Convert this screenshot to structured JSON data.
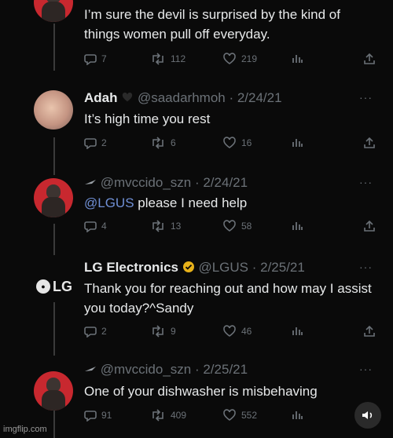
{
  "tweets": [
    {
      "text": "I’m sure the devil is surprised by the kind of things women pull off everyday.",
      "replies": "7",
      "retweets": "112",
      "likes": "219"
    },
    {
      "name": "Adah",
      "handle": "@saadarhmoh · 2/24/21",
      "text": "It’s high time you rest",
      "replies": "2",
      "retweets": "6",
      "likes": "16"
    },
    {
      "handle": "@mvccido_szn · 2/24/21",
      "mention": "@LGUS",
      "text": " please I need help",
      "replies": "4",
      "retweets": "13",
      "likes": "58"
    },
    {
      "name": "LG Electronics",
      "handle": "@LGUS · 2/25/21",
      "logo": "LG",
      "text": "Thank you for reaching out and how may I assist you today?^Sandy",
      "replies": "2",
      "retweets": "9",
      "likes": "46"
    },
    {
      "handle": "@mvccido_szn · 2/25/21",
      "text": "One of your dishwasher is misbehaving",
      "replies": "91",
      "retweets": "409",
      "likes": "552"
    }
  ],
  "more_label": "···",
  "watermark": "imgflip.com",
  "colors": {
    "accent": "#1d9bf0",
    "avatar_red": "#c8282f",
    "muted": "#6b7177"
  }
}
